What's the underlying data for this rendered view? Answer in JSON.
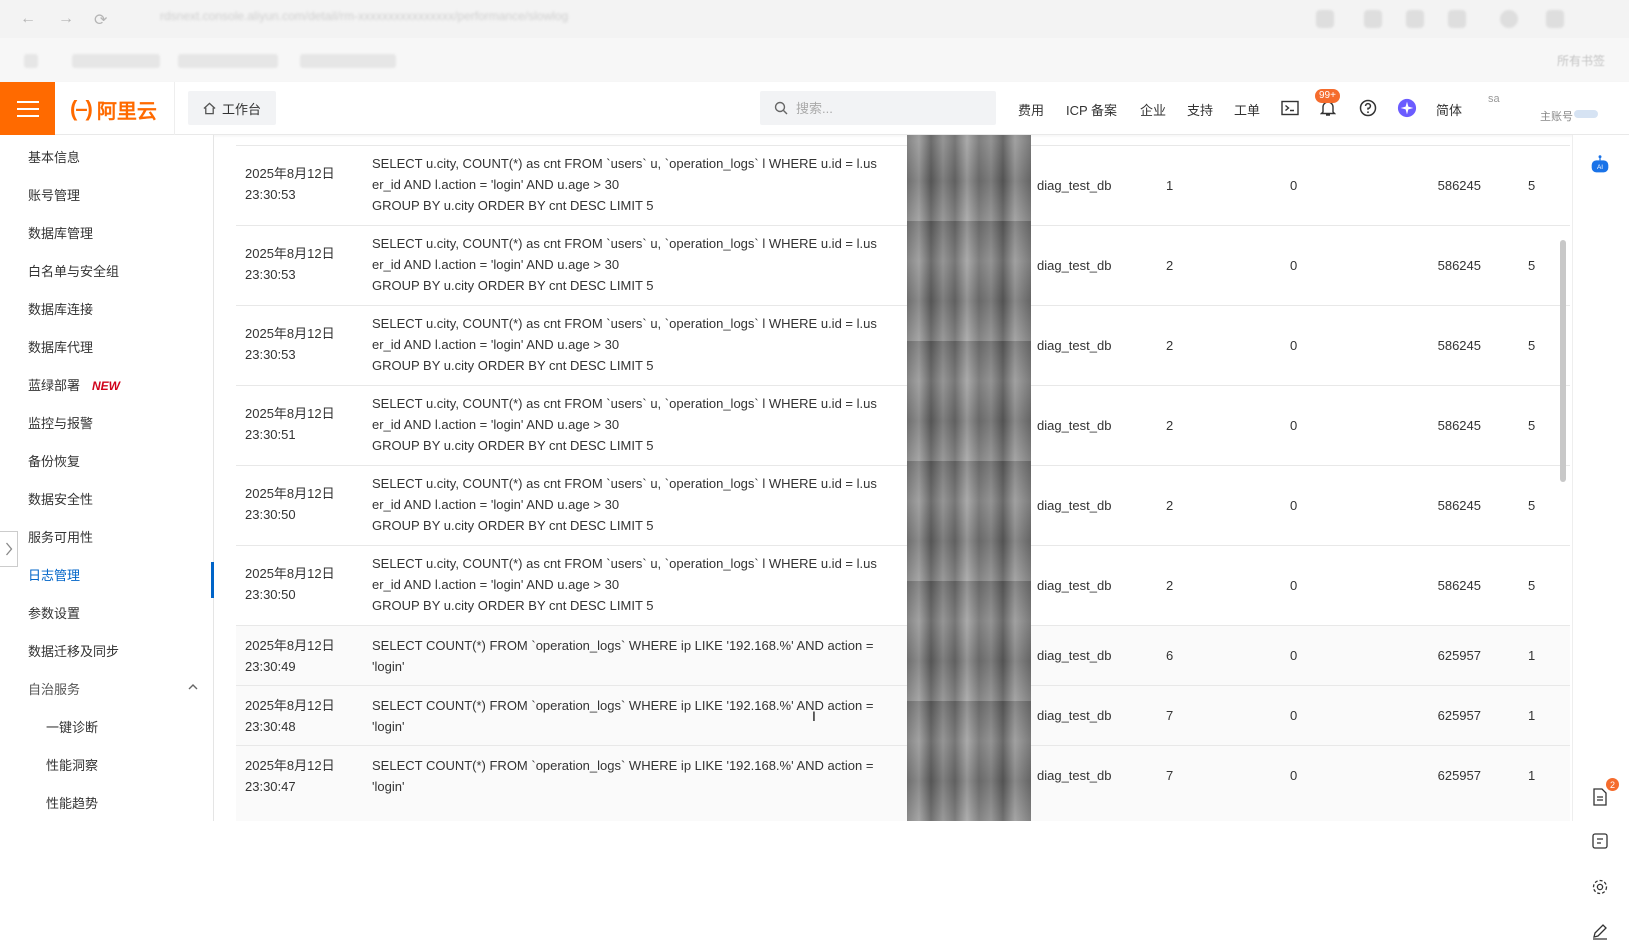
{
  "header": {
    "brand": "阿里云",
    "workbench_label": "工作台",
    "search_placeholder": "搜索...",
    "links": [
      "费用",
      "ICP 备案",
      "企业",
      "支持",
      "工单"
    ],
    "notification_count": "99+",
    "language": "简体",
    "account_name": "sa",
    "account_role": "主账号"
  },
  "bookmarks": {
    "all_label": "所有书签"
  },
  "sidebar": {
    "items": [
      {
        "label": "基本信息"
      },
      {
        "label": "账号管理"
      },
      {
        "label": "数据库管理"
      },
      {
        "label": "白名单与安全组"
      },
      {
        "label": "数据库连接"
      },
      {
        "label": "数据库代理"
      },
      {
        "label": "蓝绿部署",
        "tag": "NEW"
      },
      {
        "label": "监控与报警"
      },
      {
        "label": "备份恢复"
      },
      {
        "label": "数据安全性"
      },
      {
        "label": "服务可用性"
      },
      {
        "label": "日志管理",
        "active": true
      },
      {
        "label": "参数设置"
      },
      {
        "label": "数据迁移及同步"
      },
      {
        "label": "自治服务",
        "expandable": true
      },
      {
        "label": "一键诊断",
        "sub": true
      },
      {
        "label": "性能洞察",
        "sub": true
      },
      {
        "label": "性能趋势",
        "sub": true
      }
    ]
  },
  "table": {
    "rows": [
      {
        "time": "2025年8月12日 23:30:53",
        "sql": "SELECT u.city, COUNT(*) as cnt FROM `users` u, `operation_logs` l WHERE u.id = l.user_id AND l.action = 'login' AND u.age > 30\nGROUP BY u.city ORDER BY cnt DESC LIMIT 5",
        "db": "diag_test_db",
        "v1": "1",
        "v2": "0",
        "v3": "586245",
        "v4": "5"
      },
      {
        "time": "2025年8月12日 23:30:53",
        "sql": "SELECT u.city, COUNT(*) as cnt FROM `users` u, `operation_logs` l WHERE u.id = l.user_id AND l.action = 'login' AND u.age > 30\nGROUP BY u.city ORDER BY cnt DESC LIMIT 5",
        "db": "diag_test_db",
        "v1": "2",
        "v2": "0",
        "v3": "586245",
        "v4": "5"
      },
      {
        "time": "2025年8月12日 23:30:53",
        "sql": "SELECT u.city, COUNT(*) as cnt FROM `users` u, `operation_logs` l WHERE u.id = l.user_id AND l.action = 'login' AND u.age > 30\nGROUP BY u.city ORDER BY cnt DESC LIMIT 5",
        "db": "diag_test_db",
        "v1": "2",
        "v2": "0",
        "v3": "586245",
        "v4": "5"
      },
      {
        "time": "2025年8月12日 23:30:51",
        "sql": "SELECT u.city, COUNT(*) as cnt FROM `users` u, `operation_logs` l WHERE u.id = l.user_id AND l.action = 'login' AND u.age > 30\nGROUP BY u.city ORDER BY cnt DESC LIMIT 5",
        "db": "diag_test_db",
        "v1": "2",
        "v2": "0",
        "v3": "586245",
        "v4": "5"
      },
      {
        "time": "2025年8月12日 23:30:50",
        "sql": "SELECT u.city, COUNT(*) as cnt FROM `users` u, `operation_logs` l WHERE u.id = l.user_id AND l.action = 'login' AND u.age > 30\nGROUP BY u.city ORDER BY cnt DESC LIMIT 5",
        "db": "diag_test_db",
        "v1": "2",
        "v2": "0",
        "v3": "586245",
        "v4": "5"
      },
      {
        "time": "2025年8月12日 23:30:50",
        "sql": "SELECT u.city, COUNT(*) as cnt FROM `users` u, `operation_logs` l WHERE u.id = l.user_id AND l.action = 'login' AND u.age > 30\nGROUP BY u.city ORDER BY cnt DESC LIMIT 5",
        "db": "diag_test_db",
        "v1": "2",
        "v2": "0",
        "v3": "586245",
        "v4": "5"
      },
      {
        "time": "2025年8月12日 23:30:49",
        "sql": "SELECT COUNT(*) FROM `operation_logs` WHERE ip LIKE '192.168.%' AND action = 'login'",
        "db": "diag_test_db",
        "v1": "6",
        "v2": "0",
        "v3": "625957",
        "v4": "1"
      },
      {
        "time": "2025年8月12日 23:30:48",
        "sql": "SELECT COUNT(*) FROM `operation_logs` WHERE ip LIKE '192.168.%' AND action = 'login'",
        "db": "diag_test_db",
        "v1": "7",
        "v2": "0",
        "v3": "625957",
        "v4": "1"
      },
      {
        "time": "2025年8月12日 23:30:47",
        "sql": "SELECT COUNT(*) FROM `operation_logs` WHERE ip LIKE '192.168.%' AND action = 'login'",
        "db": "diag_test_db",
        "v1": "7",
        "v2": "0",
        "v3": "625957",
        "v4": "1"
      }
    ]
  },
  "right_rail": {
    "ai_label": "AI",
    "doc_badge": "2"
  },
  "colors": {
    "brand": "#ff6a00",
    "active": "#0064c8",
    "new_tag": "#d0021b"
  }
}
